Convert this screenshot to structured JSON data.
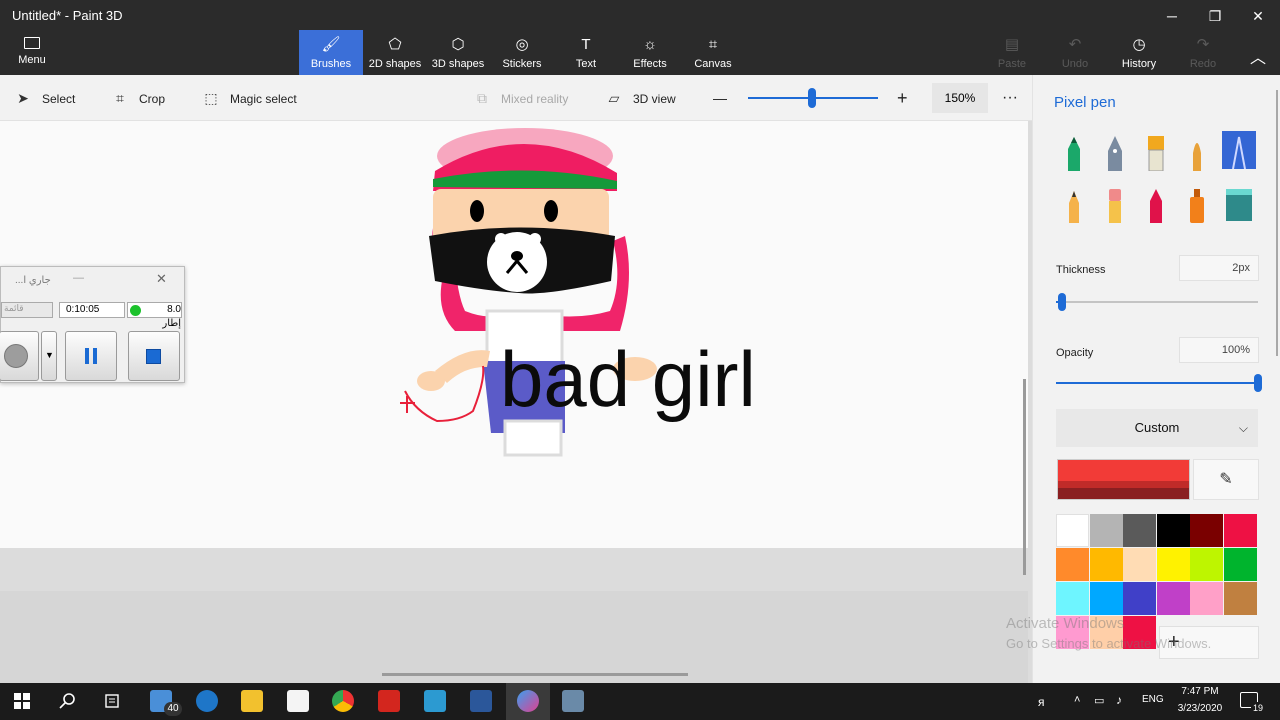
{
  "window": {
    "title": "Untitled* - Paint 3D",
    "min_glyph": "─",
    "max_glyph": "❐",
    "close_glyph": "✕"
  },
  "ribbon": {
    "menu_label": "Menu",
    "tools": [
      {
        "label": "Brushes",
        "icon": "brush-icon",
        "glyph": "🖌"
      },
      {
        "label": "2D shapes",
        "icon": "2d-shapes-icon",
        "glyph": "⬠"
      },
      {
        "label": "3D shapes",
        "icon": "3d-shapes-icon",
        "glyph": "⬡"
      },
      {
        "label": "Stickers",
        "icon": "stickers-icon",
        "glyph": "◎"
      },
      {
        "label": "Text",
        "icon": "text-icon",
        "glyph": "T"
      },
      {
        "label": "Effects",
        "icon": "effects-icon",
        "glyph": "☼"
      },
      {
        "label": "Canvas",
        "icon": "canvas-icon",
        "glyph": "⌗"
      }
    ],
    "actions": [
      {
        "label": "Paste",
        "icon": "paste-icon",
        "glyph": "▤",
        "enabled": false
      },
      {
        "label": "Undo",
        "icon": "undo-icon",
        "glyph": "↶",
        "enabled": false
      },
      {
        "label": "History",
        "icon": "history-icon",
        "glyph": "◷",
        "enabled": true
      },
      {
        "label": "Redo",
        "icon": "redo-icon",
        "glyph": "↷",
        "enabled": false
      }
    ],
    "collapse_glyph": "︿"
  },
  "toolbar": {
    "select": "Select",
    "crop": "Crop",
    "magic_select": "Magic select",
    "mixed_reality": "Mixed reality",
    "view_3d": "3D view",
    "zoom_out": "—",
    "zoom_in": "+",
    "zoom_level": "150%",
    "zoom_fraction": 0.49,
    "more": "···"
  },
  "canvas": {
    "text": "bad girl"
  },
  "recorder": {
    "title": "جاري ا...",
    "min": "—",
    "close": "✕",
    "combo": "قائمة",
    "time": "0:10:05",
    "fps": "8.0 إطار"
  },
  "panel": {
    "title": "Pixel pen",
    "thickness_label": "Thickness",
    "thickness_value": "2px",
    "thickness_fraction": 0.03,
    "opacity_label": "Opacity",
    "opacity_value": "100%",
    "opacity_fraction": 1.0,
    "color_mode": "Custom",
    "chevron": "⌵",
    "eyedropper_glyph": "✎",
    "add_color_glyph": "+",
    "selected_color": "#f23b37",
    "palette": [
      "#ffffff",
      "#b4b4b4",
      "#5a5a5a",
      "#000000",
      "#7a0000",
      "#ee1144",
      "#ff8a2b",
      "#ffb900",
      "#ffdcb4",
      "#fff200",
      "#bef500",
      "#00b42d",
      "#6ef5ff",
      "#00a8ff",
      "#4040c8",
      "#c040c8",
      "#ffa0c8",
      "#c08040",
      "#ff9ad0",
      "#ffcfa8",
      "#ee1144"
    ]
  },
  "watermark": {
    "line1": "Activate Windows",
    "line2": "Go to Settings to activate Windows."
  },
  "taskbar": {
    "badge": "40",
    "lang": "ENG",
    "time": "7:47 PM",
    "date": "3/23/2020",
    "notif": "19"
  }
}
